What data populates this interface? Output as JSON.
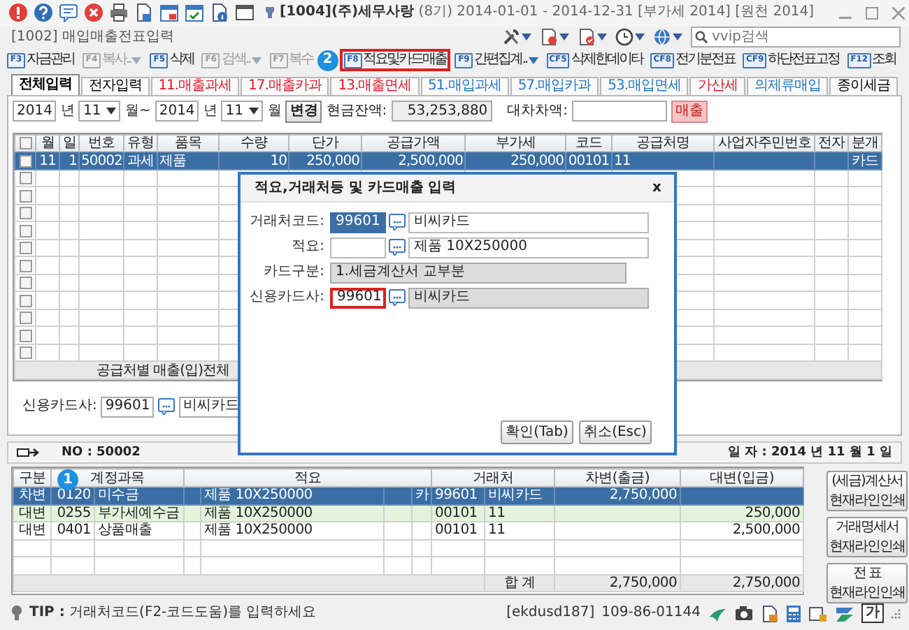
{
  "window": {
    "title": "**[1004](주)세무사랑** (8기) 2014-01-01 - 2014-12-31 [부가세 2014] [원천 2014]"
  },
  "screen_title": "[1002] 매입매출전표입력",
  "search": {
    "placeholder": "vvip검색"
  },
  "toolbar": {
    "callout": "2",
    "buttons": [
      {
        "key": "F3",
        "label": "자금관리",
        "disabled": false,
        "dropdown": false,
        "highlighted": false
      },
      {
        "key": "F4",
        "label": "복사..",
        "disabled": true,
        "dropdown": true,
        "highlighted": false
      },
      {
        "key": "F5",
        "label": "삭제",
        "disabled": false,
        "dropdown": false,
        "highlighted": false
      },
      {
        "key": "F6",
        "label": "검색..",
        "disabled": true,
        "dropdown": true,
        "highlighted": false
      },
      {
        "key": "F7",
        "label": "복수",
        "disabled": true,
        "dropdown": false,
        "highlighted": false
      },
      {
        "key": "F8",
        "label": "적요및카드매출",
        "disabled": false,
        "dropdown": false,
        "highlighted": true
      },
      {
        "key": "F9",
        "label": "간편집계..",
        "disabled": false,
        "dropdown": true,
        "highlighted": false
      },
      {
        "key": "CF5",
        "label": "삭제한데이타",
        "disabled": false,
        "dropdown": false,
        "highlighted": false
      },
      {
        "key": "CF8",
        "label": "전기분전표",
        "disabled": false,
        "dropdown": false,
        "highlighted": false
      },
      {
        "key": "CF9",
        "label": "하단전표고정",
        "disabled": false,
        "dropdown": false,
        "highlighted": false
      },
      {
        "key": "F12",
        "label": "조회",
        "disabled": false,
        "dropdown": false,
        "highlighted": false
      }
    ]
  },
  "tabs": [
    {
      "label": "전체입력",
      "selected": true,
      "color": "#000000"
    },
    {
      "label": "전자입력",
      "selected": false,
      "color": "#000000"
    },
    {
      "label": "11.매출과세",
      "selected": false,
      "color": "#e8192c"
    },
    {
      "label": "17.매출카과",
      "selected": false,
      "color": "#e8192c"
    },
    {
      "label": "13.매출면세",
      "selected": false,
      "color": "#e8192c"
    },
    {
      "label": "51.매입과세",
      "selected": false,
      "color": "#2277cc"
    },
    {
      "label": "57.매입카과",
      "selected": false,
      "color": "#2277cc"
    },
    {
      "label": "53.매입면세",
      "selected": false,
      "color": "#2277cc"
    },
    {
      "label": "가산세",
      "selected": false,
      "color": "#e8192c"
    },
    {
      "label": "의제류매입",
      "selected": false,
      "color": "#2277cc"
    },
    {
      "label": "종이세금",
      "selected": false,
      "color": "#000000"
    }
  ],
  "period": {
    "from_year": "2014",
    "from_year_unit": "년",
    "from_month": "11",
    "from_month_unit": "월~",
    "to_year": "2014",
    "to_year_unit": "년",
    "to_month": "11",
    "to_month_unit": "월",
    "change_button": "변경",
    "cash_label": "현금잔액:",
    "cash_value": "53,253,880",
    "difference_label": "대차차액:",
    "type_button": "매출"
  },
  "grid": {
    "header_checked": false,
    "columns": [
      "월",
      "일",
      "번호",
      "유형",
      "품목",
      "수량",
      "단가",
      "공급가액",
      "부가세",
      "코드",
      "공급처명",
      "사업자주민번호",
      "전자",
      "분개"
    ],
    "rows": [
      {
        "checked": false,
        "selected": true,
        "cells": [
          "11",
          "1",
          "50002",
          "과세",
          "제품",
          "10",
          "250,000",
          "2,500,000",
          "250,000",
          "00101",
          "11",
          null,
          null,
          "카드"
        ]
      },
      {
        "checked": false,
        "selected": false
      },
      {
        "checked": false,
        "selected": false
      },
      {
        "checked": false,
        "selected": false
      },
      {
        "checked": false,
        "selected": false
      },
      {
        "checked": false,
        "selected": false
      },
      {
        "checked": false,
        "selected": false
      },
      {
        "checked": false,
        "selected": false
      },
      {
        "checked": false,
        "selected": false
      },
      {
        "checked": false,
        "selected": false
      },
      {
        "checked": false,
        "selected": false
      },
      {
        "checked": false,
        "selected": false
      }
    ],
    "footer": "공급처별 매출(입)전체"
  },
  "card_company": {
    "label": "신용카드사:",
    "code": "99601",
    "name": "비씨카드"
  },
  "dialog": {
    "title": "적요,거래처등 및 카드매출 입력",
    "close": "x",
    "fields": [
      {
        "label": "거래처코드:",
        "kind": "lookup",
        "code": "99601",
        "code_selected": true,
        "code_highlighted": false,
        "value": "비씨카드",
        "readonly": false
      },
      {
        "label": "적요:",
        "kind": "lookup",
        "code_selected": false,
        "code_highlighted": false,
        "value": "제품 10X250000",
        "readonly": false
      },
      {
        "label": "카드구분:",
        "kind": "text",
        "value": "1.세금계산서 교부분",
        "readonly": true
      },
      {
        "label": "신용카드사:",
        "kind": "lookup",
        "code": "99601",
        "code_selected": false,
        "code_highlighted": true,
        "value": "비씨카드",
        "readonly": true
      }
    ],
    "buttons": [
      "확인(Tab)",
      "취소(Esc)"
    ]
  },
  "voucher": {
    "number": "NO : 50002",
    "date": "일 자 : 2014 년 11 월 1 일"
  },
  "journal": {
    "callout": "1",
    "columns": [
      "구분",
      "계정과목",
      "적요",
      "거래처",
      "차변(출금)",
      "대변(입금)"
    ],
    "rows": [
      {
        "side": "차변",
        "account_code": "0120",
        "account": "미수금",
        "memo": "제품 10X250000",
        "card_mark": "카",
        "partner_code": "99601",
        "partner": "비씨카드",
        "debit": "2,750,000",
        "selected": true,
        "highlighted": false
      },
      {
        "side": "대변",
        "account_code": "0255",
        "account": "부가세예수금",
        "memo": "제품 10X250000",
        "partner_code": "00101",
        "partner": "11",
        "credit": "250,000",
        "selected": false,
        "highlighted": true
      },
      {
        "side": "대변",
        "account_code": "0401",
        "account": "상품매출",
        "memo": "제품 10X250000",
        "partner_code": "00101",
        "partner": "11",
        "credit": "2,500,000",
        "selected": false,
        "highlighted": false
      },
      {
        "selected": false,
        "highlighted": false
      },
      {
        "selected": false,
        "highlighted": false
      }
    ],
    "total": {
      "label": "합 계",
      "debit": "2,750,000",
      "credit": "2,750,000"
    }
  },
  "print_buttons": [
    {
      "title": "(세금)계산서",
      "subtitle": "현재라인인쇄"
    },
    {
      "title": "거래명세서",
      "subtitle": "현재라인인쇄"
    },
    {
      "title": "전 표",
      "subtitle": "현재라인인쇄"
    }
  ],
  "status_bar": {
    "tip": "**TIP :** 거래처코드(F2-코드도움)를 입력하세요",
    "user": "[ekdusd187]",
    "business_number": "109-86-01144",
    "ime": "가"
  }
}
